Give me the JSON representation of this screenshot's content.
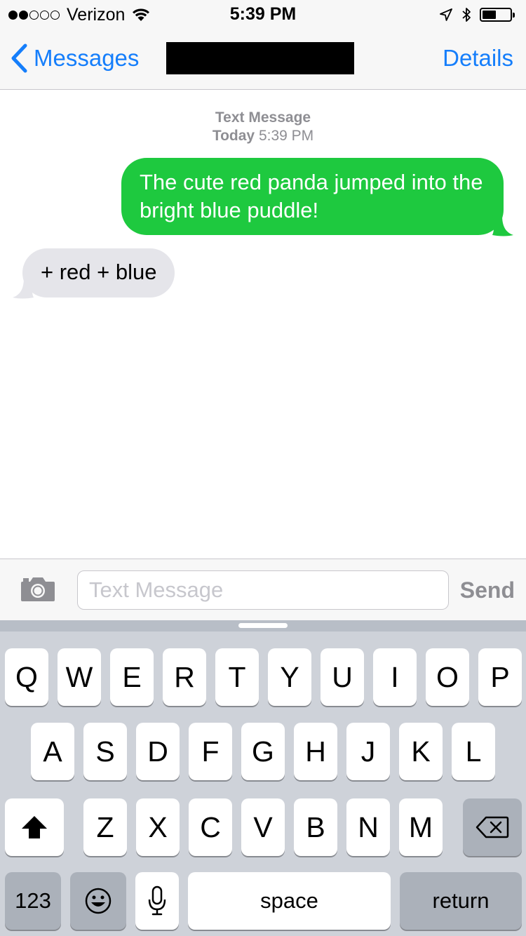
{
  "status_bar": {
    "carrier": "Verizon",
    "signal_strength": 2,
    "signal_max": 5,
    "time": "5:39 PM",
    "battery_level": 0.5
  },
  "nav": {
    "back_label": "Messages",
    "details_label": "Details"
  },
  "conversation": {
    "meta_type": "Text Message",
    "meta_day": "Today",
    "meta_time": "5:39 PM",
    "messages": [
      {
        "direction": "outgoing",
        "text": "The cute red panda jumped into the bright blue puddle!"
      },
      {
        "direction": "incoming",
        "text": "+ red + blue"
      }
    ]
  },
  "composer": {
    "placeholder": "Text Message",
    "send_label": "Send"
  },
  "keyboard": {
    "row1": [
      "Q",
      "W",
      "E",
      "R",
      "T",
      "Y",
      "U",
      "I",
      "O",
      "P"
    ],
    "row2": [
      "A",
      "S",
      "D",
      "F",
      "G",
      "H",
      "J",
      "K",
      "L"
    ],
    "row3": [
      "Z",
      "X",
      "C",
      "V",
      "B",
      "N",
      "M"
    ],
    "numbers_label": "123",
    "space_label": "space",
    "return_label": "return"
  },
  "colors": {
    "accent": "#157efb",
    "outgoing_bubble": "#1ec93f",
    "incoming_bubble": "#e5e5ea"
  }
}
